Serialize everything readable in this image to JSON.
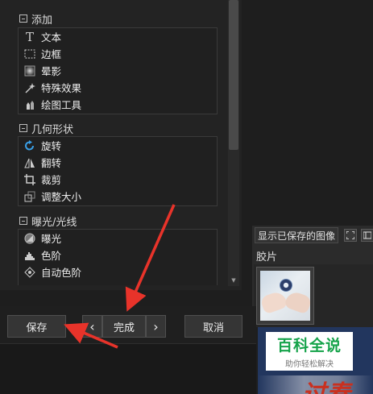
{
  "sections": [
    {
      "title": "添加",
      "items": [
        {
          "label": "文本",
          "icon": "text-icon"
        },
        {
          "label": "边框",
          "icon": "border-icon"
        },
        {
          "label": "晕影",
          "icon": "vignette-icon"
        },
        {
          "label": "特殊效果",
          "icon": "magic-wand-icon"
        },
        {
          "label": "绘图工具",
          "icon": "drawing-tools-icon"
        }
      ]
    },
    {
      "title": "几何形状",
      "items": [
        {
          "label": "旋转",
          "icon": "rotate-icon"
        },
        {
          "label": "翻转",
          "icon": "flip-icon"
        },
        {
          "label": "裁剪",
          "icon": "crop-icon"
        },
        {
          "label": "调整大小",
          "icon": "resize-icon"
        }
      ]
    },
    {
      "title": "曝光/光线",
      "items": [
        {
          "label": "曝光",
          "icon": "exposure-icon"
        },
        {
          "label": "色阶",
          "icon": "levels-icon"
        },
        {
          "label": "自动色阶",
          "icon": "auto-levels-icon"
        }
      ]
    }
  ],
  "right_panel": {
    "show_saved_label": "显示已保存的图像",
    "film_label": "胶片"
  },
  "buttons": {
    "save": "保存",
    "prev": "‹",
    "done": "完成",
    "next": "›",
    "cancel": "取消"
  },
  "watermark": {
    "title": "百科全说",
    "subtitle": "助你轻松解决",
    "red_text": "过春"
  },
  "colors": {
    "annotation_arrow": "#e8332a",
    "watermark_green": "#15a34a"
  }
}
